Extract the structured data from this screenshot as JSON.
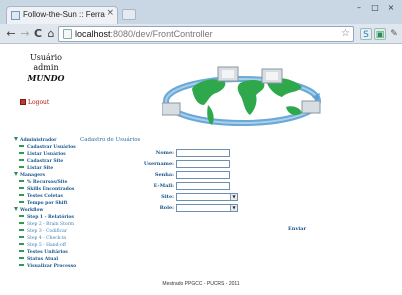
{
  "browser": {
    "tab_title": "Follow-the-Sun :: Ferramen",
    "tab_close": "×",
    "window_buttons": [
      "–",
      "□",
      "×"
    ],
    "url_host": "localhost",
    "url_path": ":8080/dev/FrontController",
    "back": "←",
    "forward": "→",
    "reload": "C",
    "home": "⌂",
    "star": "☆"
  },
  "user": {
    "label": "Usuário",
    "login": "admin",
    "name": "MUNDO"
  },
  "logout": "Logout",
  "menu": {
    "sections": [
      {
        "title": "Administrador",
        "items": [
          "Cadastrar Usuários",
          "Listar Usuários",
          "Cadastrar Site",
          "Listar Site"
        ]
      },
      {
        "title": "Managers",
        "items": [
          "% Recursos/Site",
          "Skills Encontrados",
          "Testes Coletas",
          "Tempo por Shift"
        ]
      },
      {
        "title": "Workflow",
        "items": [
          "Step 1 - Relatórios",
          "Step 2 - Brain Storm",
          "Step 3 - Codificar",
          "Step 4 - Check-in",
          "Step 5 - Hand-off",
          "Testes Unitários",
          "Status Atual",
          "Visualizar Processo"
        ]
      }
    ]
  },
  "form": {
    "title": "Cadastro de Usuários",
    "fields": {
      "nome": "Nome:",
      "username": "Username:",
      "senha": "Senha:",
      "email": "E-Mail:",
      "site": "Site:",
      "role": "Role:"
    },
    "submit": "Enviar"
  },
  "footer": "Mestrado PPGCC - PUCRS - 2011",
  "colors": {
    "menu_link": "#16548a",
    "menu_bullet": "#2e9a55",
    "globe_land": "#2ea84a",
    "globe_ring": "#5aa0d6"
  }
}
